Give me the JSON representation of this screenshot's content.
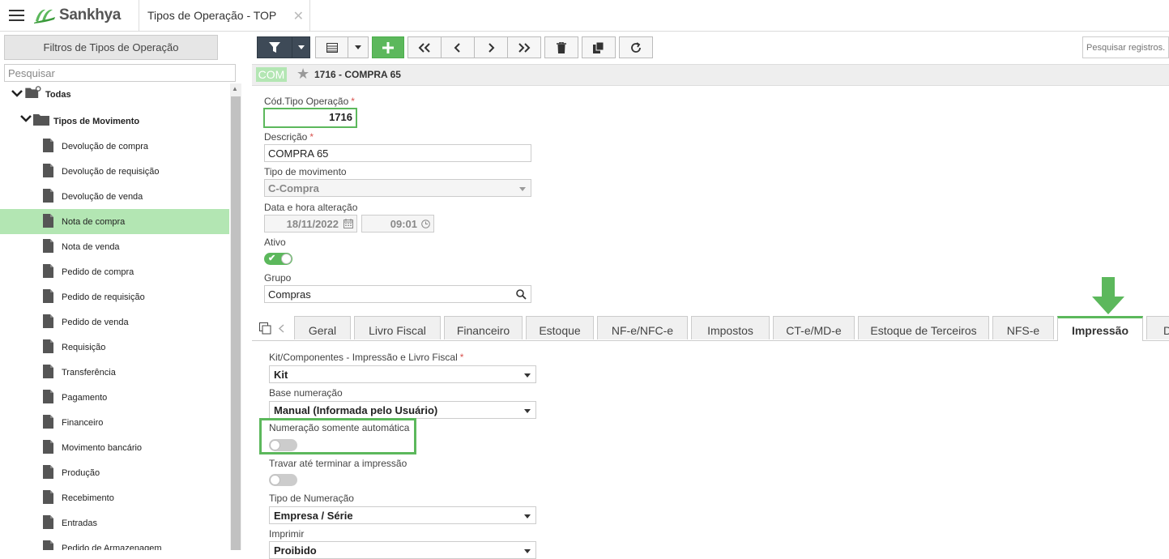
{
  "topbar": {
    "logo_text": "Sankhya",
    "tab_title": "Tipos de Operação - TOP",
    "close_glyph": "✕"
  },
  "left": {
    "filter_title": "Filtros de Tipos de Operação",
    "search_placeholder": "Pesquisar",
    "root": "Todas",
    "group": "Tipos de Movimento",
    "items": [
      "Devolução de compra",
      "Devolução de requisição",
      "Devolução de venda",
      "Nota de compra",
      "Nota de venda",
      "Pedido de compra",
      "Pedido de requisição",
      "Pedido de venda",
      "Requisição",
      "Transferência",
      "Pagamento",
      "Financeiro",
      "Movimento bancário",
      "Produção",
      "Recebimento",
      "Entradas",
      "Pedido de Armazenagem"
    ],
    "selected_index": 3
  },
  "toolbar": {
    "search_placeholder": "Pesquisar registros..."
  },
  "record": {
    "badge": "COM",
    "title": "1716 - COMPRA 65"
  },
  "form": {
    "code_label": "Cód.Tipo Operação",
    "code_value": "1716",
    "desc_label": "Descrição",
    "desc_value": "COMPRA 65",
    "movtype_label": "Tipo de movimento",
    "movtype_value": "C-Compra",
    "datetime_label": "Data e hora alteração",
    "date_value": "18/11/2022",
    "time_value": "09:01",
    "active_label": "Ativo",
    "group_label": "Grupo",
    "group_value": "Compras",
    "required_mark": "*"
  },
  "tabs": [
    "Geral",
    "Livro Fiscal",
    "Financeiro",
    "Estoque",
    "NF-e/NFC-e",
    "Impostos",
    "CT-e/MD-e",
    "Estoque de Terceiros",
    "NFS-e",
    "Impressão",
    "De"
  ],
  "active_tab": "Impressão",
  "print": {
    "kit_label": "Kit/Componentes - Impressão e Livro Fiscal",
    "kit_value": "Kit",
    "base_label": "Base numeração",
    "base_value": "Manual (Informada pelo Usuário)",
    "auto_label": "Numeração somente automática",
    "lock_label": "Travar até terminar a impressão",
    "numtype_label": "Tipo de Numeração",
    "numtype_value": "Empresa / Série",
    "print_label": "Imprimir",
    "print_value": "Proibido"
  },
  "colors": {
    "accent_green": "#5cb85c",
    "selected_row": "#b3e6b3",
    "dark_button": "#3e4a57"
  }
}
